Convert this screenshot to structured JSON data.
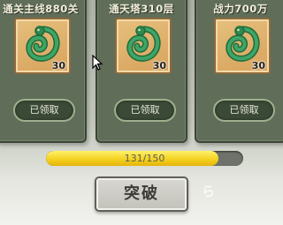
{
  "cards": [
    {
      "title": "通关主线880关",
      "quantity": "30",
      "status": "已领取",
      "icon": "jade-dragon-icon"
    },
    {
      "title": "通天塔310层",
      "quantity": "30",
      "status": "已领取",
      "icon": "jade-dragon-icon"
    },
    {
      "title": "战力700万",
      "quantity": "30",
      "status": "已领取",
      "icon": "jade-dragon-icon"
    }
  ],
  "progress": {
    "text": "131/150",
    "current": 131,
    "total": 150
  },
  "actions": {
    "breakthrough_label": "突破"
  },
  "watermark": {
    "text": "ら"
  },
  "colors": {
    "card": "#5f6d59",
    "item_bg": "#d7a35c",
    "dragon": "#2f8a52",
    "progress_fill": "#f2cf1c"
  }
}
